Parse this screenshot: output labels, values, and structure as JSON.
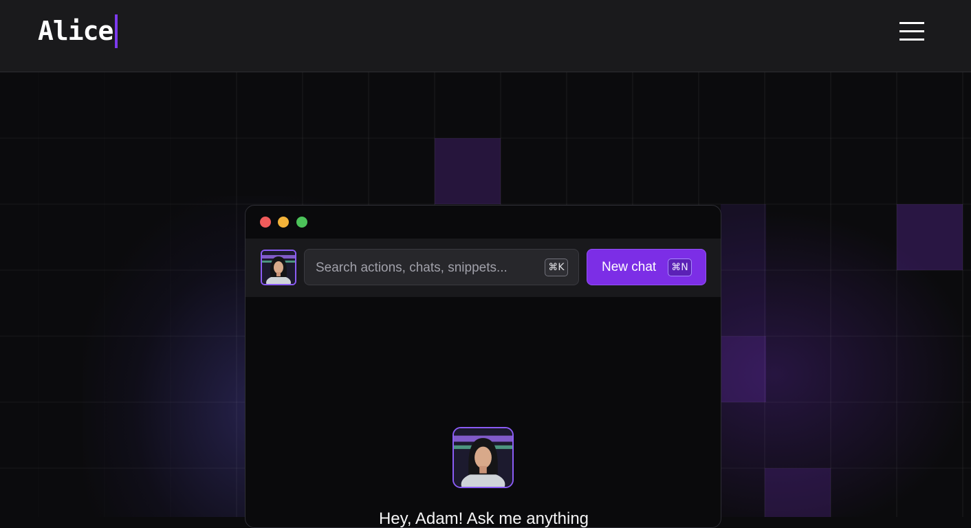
{
  "header": {
    "logo_text": "Alice",
    "menu_icon": "hamburger-menu-icon"
  },
  "app_window": {
    "traffic_lights": [
      "#ff5f57",
      "#febc2e",
      "#28c840"
    ],
    "search": {
      "placeholder": "Search actions, chats, snippets...",
      "shortcut": "⌘K"
    },
    "new_chat": {
      "label": "New chat",
      "shortcut": "⌘N"
    },
    "greeting": "Hey, Adam! Ask me anything"
  },
  "colors": {
    "accent": "#7c2ee6",
    "header_bg": "#1a1a1c",
    "page_bg": "#0b0b0d",
    "window_bg": "#0a0a0c"
  }
}
